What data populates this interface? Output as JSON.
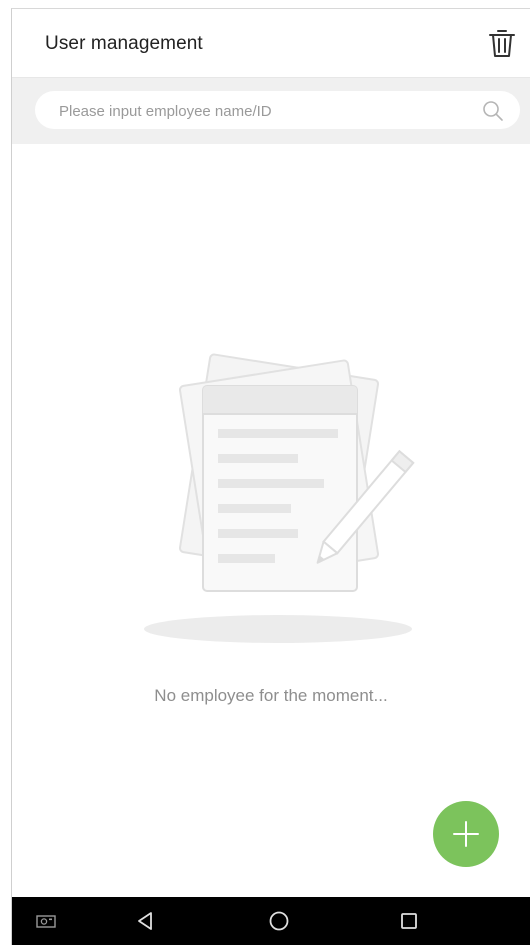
{
  "header": {
    "title": "User management",
    "delete_icon": "trash-icon"
  },
  "search": {
    "placeholder": "Please input employee name/ID",
    "value": "",
    "icon": "search-icon"
  },
  "empty_state": {
    "illustration": "document-pencil-illustration",
    "message": "No employee for the moment..."
  },
  "fab": {
    "icon": "plus-icon",
    "color": "#7cc35c"
  },
  "navbar": {
    "items": [
      {
        "icon": "screenshot-icon"
      },
      {
        "icon": "back-icon"
      },
      {
        "icon": "home-icon"
      },
      {
        "icon": "recents-icon"
      }
    ]
  }
}
